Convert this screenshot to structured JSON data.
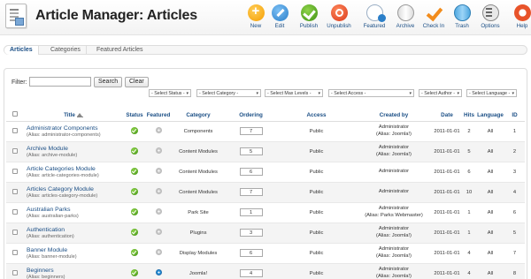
{
  "header": {
    "title": "Article Manager: Articles"
  },
  "toolbar": [
    {
      "label": "New",
      "icon": "new-icon"
    },
    {
      "label": "Edit",
      "icon": "edit-icon"
    },
    {
      "label": "Publish",
      "icon": "publish-icon"
    },
    {
      "label": "Unpublish",
      "icon": "unpublish-icon"
    },
    {
      "label": "Featured",
      "icon": "featured-icon"
    },
    {
      "label": "Archive",
      "icon": "archive-icon"
    },
    {
      "label": "Check In",
      "icon": "checkin-icon"
    },
    {
      "label": "Trash",
      "icon": "trash-icon"
    },
    {
      "label": "Options",
      "icon": "options-icon"
    },
    {
      "label": "Help",
      "icon": "help-icon"
    }
  ],
  "tabs": [
    "Articles",
    "Categories",
    "Featured Articles"
  ],
  "filter": {
    "label": "Filter:",
    "value": "",
    "search_label": "Search",
    "clear_label": "Clear"
  },
  "selects": [
    "- Select Status -",
    "- Select Category -",
    "- Select Max Levels -",
    "- Select Access -",
    "- Select Author -",
    "- Select Language -"
  ],
  "columns": [
    "Title",
    "Status",
    "Featured",
    "Category",
    "Ordering",
    "Access",
    "Created by",
    "Date",
    "Hits",
    "Language",
    "ID"
  ],
  "rows": [
    {
      "title": "Administrator Components",
      "alias": "(Alias: administrator-components)",
      "featured": false,
      "category": "Components",
      "ordering": "7",
      "access": "Public",
      "created_by": "Administrator",
      "created_alias": "(Alias: Joomla!)",
      "date": "2011-01-01",
      "hits": "2",
      "language": "All",
      "id": "1"
    },
    {
      "title": "Archive Module",
      "alias": "(Alias: archive-module)",
      "featured": false,
      "category": "Content Modules",
      "ordering": "5",
      "access": "Public",
      "created_by": "Administrator",
      "created_alias": "(Alias: Joomla!)",
      "date": "2011-01-01",
      "hits": "5",
      "language": "All",
      "id": "2"
    },
    {
      "title": "Article Categories Module",
      "alias": "(Alias: article-categories-module)",
      "featured": false,
      "category": "Content Modules",
      "ordering": "6",
      "access": "Public",
      "created_by": "Administrator",
      "created_alias": "",
      "date": "2011-01-01",
      "hits": "6",
      "language": "All",
      "id": "3"
    },
    {
      "title": "Articles Category Module",
      "alias": "(Alias: articles-category-module)",
      "featured": false,
      "category": "Content Modules",
      "ordering": "7",
      "access": "Public",
      "created_by": "Administrator",
      "created_alias": "",
      "date": "2011-01-01",
      "hits": "10",
      "language": "All",
      "id": "4"
    },
    {
      "title": "Australian Parks",
      "alias": "(Alias: australian-parks)",
      "featured": false,
      "category": "Park Site",
      "ordering": "1",
      "access": "Public",
      "created_by": "Administrator",
      "created_alias": "(Alias: Parks Webmaster)",
      "date": "2011-01-01",
      "hits": "1",
      "language": "All",
      "id": "6"
    },
    {
      "title": "Authentication",
      "alias": "(Alias: authentication)",
      "featured": false,
      "category": "Plugins",
      "ordering": "3",
      "access": "Public",
      "created_by": "Administrator",
      "created_alias": "(Alias: Joomla!)",
      "date": "2011-01-01",
      "hits": "1",
      "language": "All",
      "id": "5"
    },
    {
      "title": "Banner Module",
      "alias": "(Alias: banner-module)",
      "featured": false,
      "category": "Display Modules",
      "ordering": "6",
      "access": "Public",
      "created_by": "Administrator",
      "created_alias": "(Alias: Joomla!)",
      "date": "2011-01-01",
      "hits": "4",
      "language": "All",
      "id": "7"
    },
    {
      "title": "Beginners",
      "alias": "(Alias: beginners)",
      "featured": true,
      "category": "Joomla!",
      "ordering": "4",
      "access": "Public",
      "created_by": "Administrator",
      "created_alias": "(Alias: Joomla!)",
      "date": "2011-01-01",
      "hits": "4",
      "language": "All",
      "id": "8"
    }
  ]
}
